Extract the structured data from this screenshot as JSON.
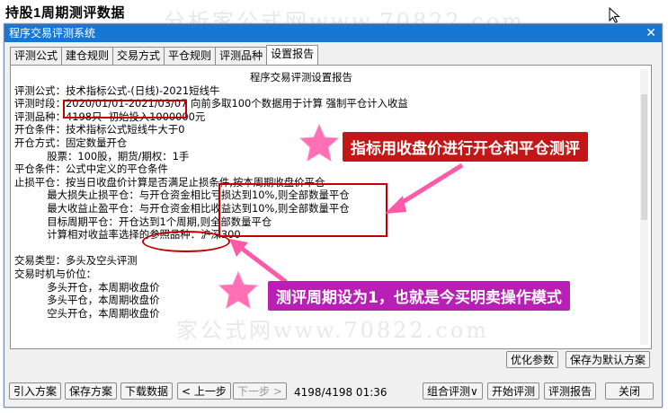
{
  "page": {
    "title": "持股1周期测评数据"
  },
  "watermark": {
    "top": "分析家公式网www.70822.com",
    "bottom": "家公式网www.70822.com"
  },
  "window": {
    "title": "程序交易评测系统",
    "close": "✕"
  },
  "tabs": [
    "评测公式",
    "建仓规则",
    "交易方式",
    "平仓规则",
    "评测品种",
    "设置报告"
  ],
  "active_tab": 5,
  "report_lines": [
    "程序交易评测设置报告",
    "评测公式：技术指标公式-(日线)-2021短线牛",
    "评测时段：2020/01/01-2021/03/07 向前多取100个数据用于计算 强制平仓计入收益",
    "评测品种：4198只  初始投入1000000元",
    "开仓条件：技术指标公式短线牛大于0",
    "开仓方式：固定数量开仓",
    "          股票：100股，期货/期权：1手",
    "平仓条件：公式中定义的平仓条件",
    "止损平仓：按当日收盘价计算是否满足止损条件,按本周期收盘价平仓",
    "          最大损失止损平仓：与开仓资金相比亏损达到10%,则全部数量平仓",
    "          最大收益止盈平仓：与开仓资金相比收益达到10%,则全部数量平仓",
    "          目标周期平仓：开仓达到1个周期,则全部数量平仓",
    "          计算相对收益率选择的参照品种：沪深300",
    "",
    "交易类型：多头及空头评测",
    "交易时机与价位：",
    "          多头开仓，本周期收盘价",
    "          多头平仓，本周期收盘价",
    "          空头开仓，本周期收盘价"
  ],
  "buttons": {
    "optimize": "优化参数",
    "save_default": "保存为默认方案",
    "import": "引入方案",
    "save": "保存方案",
    "download": "下载数据",
    "prev": "< 上一步",
    "next": "下一步 >",
    "combo": "组合评测∨",
    "start": "开始评测",
    "report": "评测报告",
    "close": "关闭"
  },
  "status_text": "4198/4198 01:36",
  "annotations": {
    "callout_top": "指标用收盘价进行开仓和平仓测评",
    "callout_bottom": "测评周期设为1，也就是今买明卖操作模式"
  },
  "colors": {
    "titlebar": "#1777d3",
    "annotation_red": "#c31717",
    "annotation_pink": "#b71fb5",
    "star": "#ff6fb4"
  }
}
